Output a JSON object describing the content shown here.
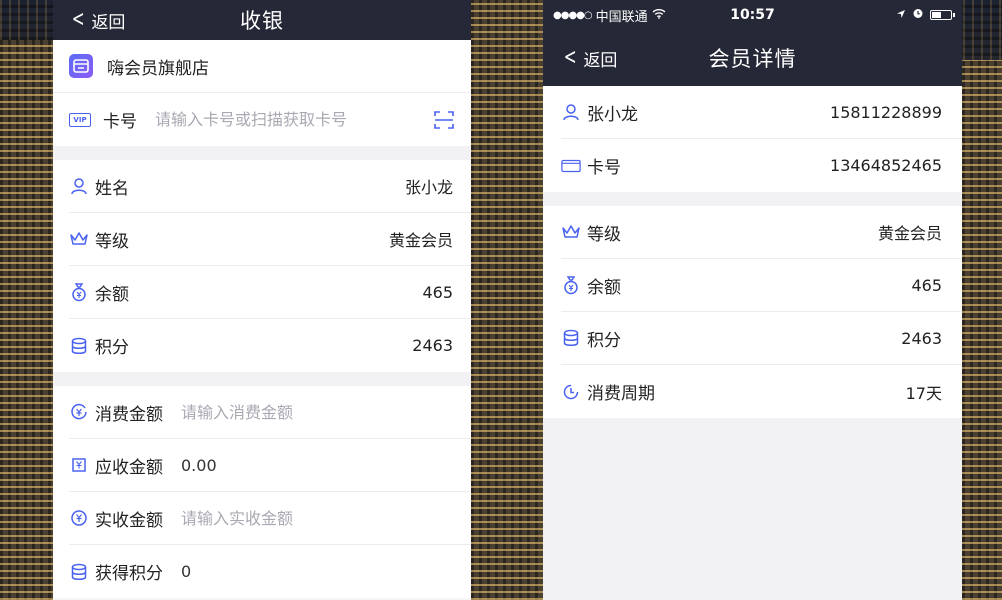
{
  "left": {
    "nav": {
      "back_label": "返回",
      "title": "收银"
    },
    "store": {
      "name": "嗨会员旗舰店"
    },
    "card": {
      "label": "卡号",
      "badge": "VIP",
      "placeholder": "请输入卡号或扫描获取卡号"
    },
    "member": [
      {
        "label": "姓名",
        "value": "张小龙",
        "icon": "user-icon"
      },
      {
        "label": "等级",
        "value": "黄金会员",
        "icon": "crown-icon"
      },
      {
        "label": "余额",
        "value": "465",
        "icon": "money-bag-icon"
      },
      {
        "label": "积分",
        "value": "2463",
        "icon": "database-icon"
      }
    ],
    "payment": {
      "consume": {
        "label": "消费金额",
        "placeholder": "请输入消费金额"
      },
      "receivable": {
        "label": "应收金额",
        "value": "0.00"
      },
      "received": {
        "label": "实收金额",
        "placeholder": "请输入实收金额"
      },
      "points": {
        "label": "获得积分",
        "value": "0"
      }
    }
  },
  "right": {
    "status": {
      "carrier": "中国联通",
      "time": "10:57"
    },
    "nav": {
      "back_label": "返回",
      "title": "会员详情"
    },
    "top": [
      {
        "label": "张小龙",
        "value": "15811228899",
        "icon": "user-icon"
      },
      {
        "label": "卡号",
        "value": "13464852465",
        "icon": "vip-card-icon"
      }
    ],
    "details": [
      {
        "label": "等级",
        "value": "黄金会员",
        "icon": "crown-icon"
      },
      {
        "label": "余额",
        "value": "465",
        "icon": "money-bag-icon"
      },
      {
        "label": "积分",
        "value": "2463",
        "icon": "database-icon"
      },
      {
        "label": "消费周期",
        "value": "17天",
        "icon": "clock-icon"
      }
    ]
  },
  "colors": {
    "accent": "#4a62f0",
    "navbar": "#252836"
  }
}
